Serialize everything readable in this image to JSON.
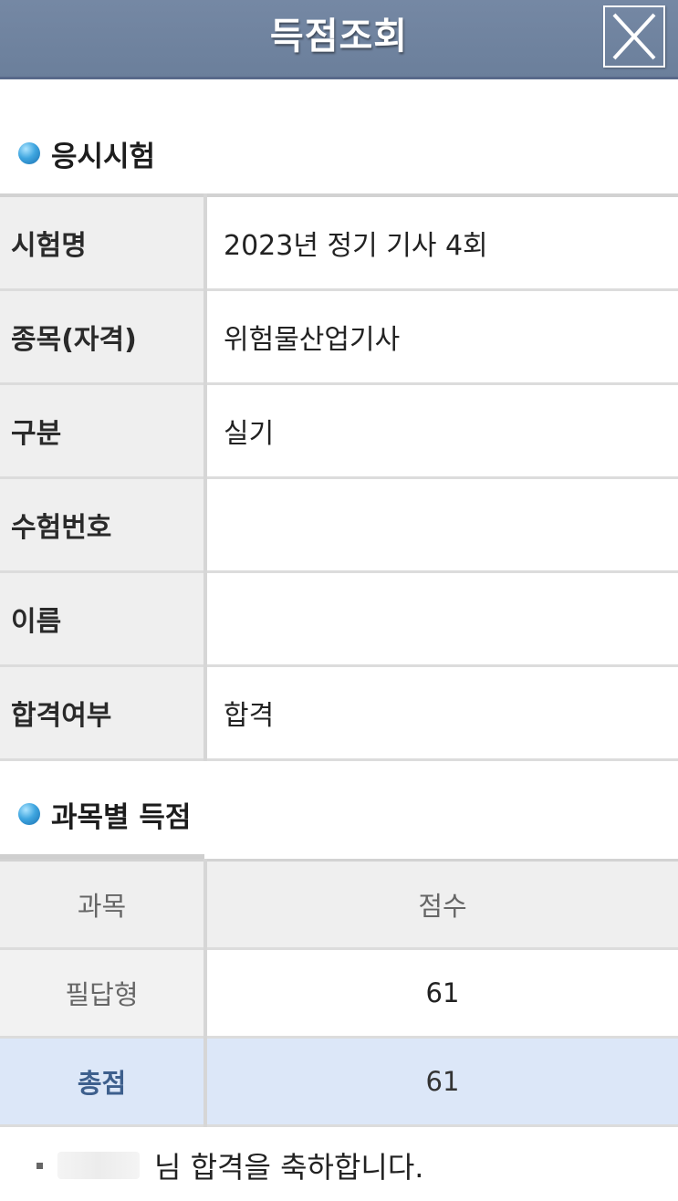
{
  "header": {
    "title": "득점조회",
    "close_icon": "close-x-icon"
  },
  "exam_section": {
    "title": "응시시험",
    "rows": [
      {
        "label": "시험명",
        "value": "2023년 정기 기사 4회"
      },
      {
        "label": "종목(자격)",
        "value": "위험물산업기사"
      },
      {
        "label": "구분",
        "value": "실기"
      },
      {
        "label": "수험번호",
        "value": ""
      },
      {
        "label": "이름",
        "value": ""
      },
      {
        "label": "합격여부",
        "value": "합격"
      }
    ]
  },
  "score_section": {
    "title": "과목별 득점",
    "headers": {
      "subject": "과목",
      "score": "점수"
    },
    "rows": [
      {
        "subject": "필답형",
        "score": "61"
      }
    ],
    "total": {
      "label": "총점",
      "score": "61"
    }
  },
  "message": {
    "text": "님 합격을 축하합니다."
  },
  "colors": {
    "header_bg": "#6f839f",
    "label_bg": "#efefef",
    "total_row_bg": "#dce7f8",
    "total_label": "#3d5f8d",
    "bullet": "#3fa6e0"
  }
}
